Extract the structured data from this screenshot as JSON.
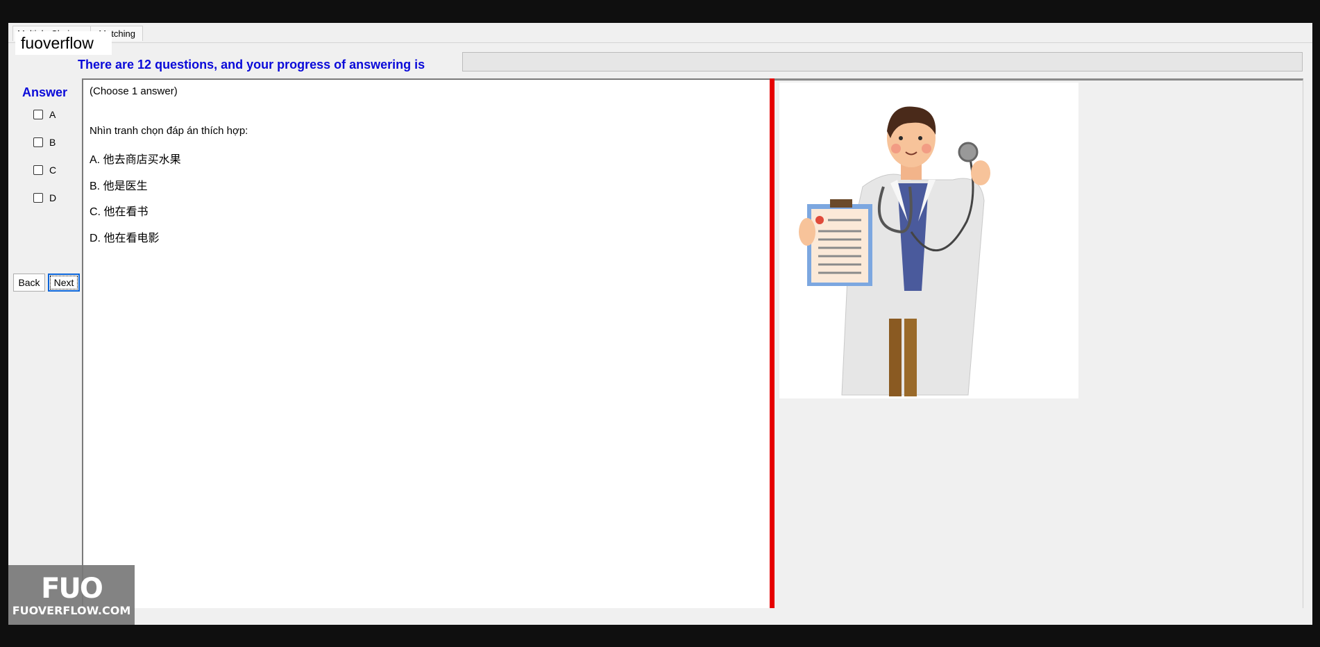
{
  "tabs": [
    {
      "label": "Multiple Choice"
    },
    {
      "label": "Matching"
    }
  ],
  "brand_label": "fuoverflow",
  "progress": {
    "label": "There are 12 questions, and your progress of answering is",
    "value": 0
  },
  "answer": {
    "heading": "Answer",
    "options": [
      "A",
      "B",
      "C",
      "D"
    ]
  },
  "nav": {
    "back": "Back",
    "next": "Next"
  },
  "question": {
    "instruction": "(Choose 1 answer)",
    "prompt": "Nhìn tranh chọn đáp án thích hợp:",
    "choices": [
      "A.  他去商店买水果",
      "B.  他是医生",
      "C.  他在看书",
      "D.  他在看电影"
    ]
  },
  "image": {
    "icon": "doctor-illustration"
  },
  "logo": {
    "mark": "FUO",
    "text": "FUOVERFLOW.COM"
  },
  "colors": {
    "accent_text": "#0a0ad9",
    "splitter": "#e60000"
  }
}
